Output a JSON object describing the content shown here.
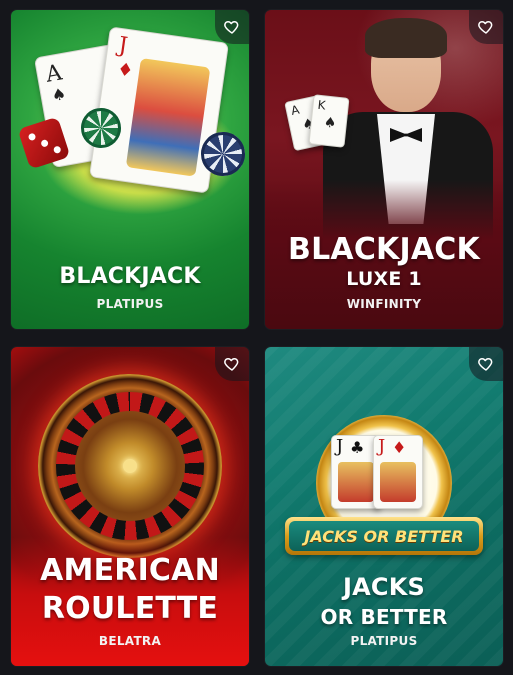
{
  "games": [
    {
      "title_line1": "BLACKJACK",
      "title_line2": "",
      "provider": "PLATIPUS"
    },
    {
      "title_line1": "BLACKJACK",
      "title_line2": "LUXE 1",
      "provider": "WINFINITY"
    },
    {
      "title_line1": "AMERICAN",
      "title_line2": "ROULETTE",
      "provider": "BELATRA"
    },
    {
      "title_line1": "JACKS",
      "title_line2": "OR BETTER",
      "provider": "PLATIPUS",
      "logo_text": "JACKS OR BETTER"
    }
  ],
  "icons": {
    "favorite": "heart-outline-icon"
  },
  "colors": {
    "background": "#15161b",
    "green": "#1f9a3b",
    "maroon": "#6b0f18",
    "red": "#d10f10",
    "teal": "#117a6e"
  }
}
